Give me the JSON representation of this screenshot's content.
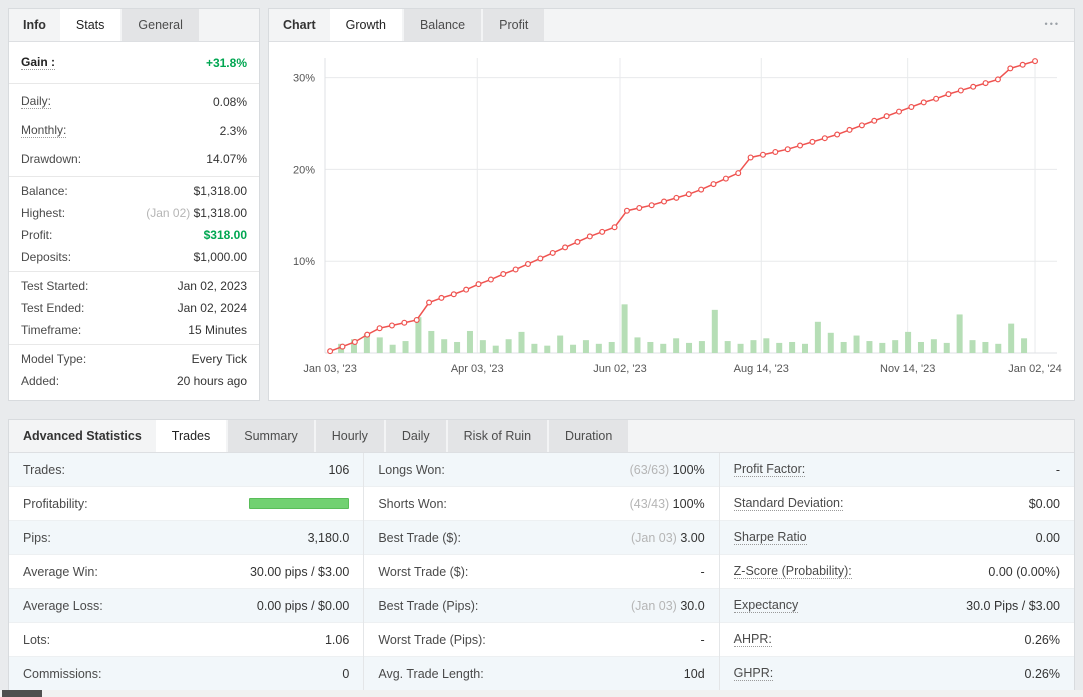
{
  "colors": {
    "accent_green": "#00a651",
    "line_red": "#ef5350",
    "bar_green": "#b6deb6",
    "profitability_green": "#71d171",
    "grid_gray": "#e8eaec",
    "muted_gray": "#b5b5b5"
  },
  "info_panel": {
    "title": "Info",
    "tabs": [
      {
        "label": "Stats",
        "active": true
      },
      {
        "label": "General",
        "active": false
      }
    ],
    "sections": [
      {
        "rows": [
          {
            "label": "Gain :",
            "value": "+31.8%",
            "dotted": true,
            "bold_label": true,
            "green": true,
            "size": "gain"
          }
        ]
      },
      {
        "rows": [
          {
            "label": "Daily:",
            "value": "0.08%",
            "dotted": true,
            "size": "tall"
          },
          {
            "label": "Monthly:",
            "value": "2.3%",
            "dotted": true,
            "size": "tall"
          },
          {
            "label": "Drawdown:",
            "value": "14.07%",
            "size": "tall"
          }
        ]
      },
      {
        "rows": [
          {
            "label": "Balance:",
            "value": "$1,318.00"
          },
          {
            "label": "Highest:",
            "prefix": "(Jan 02) ",
            "value": "$1,318.00"
          },
          {
            "label": "Profit:",
            "value": "$318.00",
            "green": true
          },
          {
            "label": "Deposits:",
            "value": "$1,000.00"
          }
        ]
      },
      {
        "rows": [
          {
            "label": "Test Started:",
            "value": "Jan 02, 2023"
          },
          {
            "label": "Test Ended:",
            "value": "Jan 02, 2024"
          },
          {
            "label": "Timeframe:",
            "value": "15 Minutes"
          }
        ]
      },
      {
        "rows": [
          {
            "label": "Model Type:",
            "value": "Every Tick"
          },
          {
            "label": "Added:",
            "value": "20 hours ago"
          }
        ]
      }
    ]
  },
  "chart_panel": {
    "title": "Chart",
    "tabs": [
      {
        "label": "Growth",
        "active": true
      },
      {
        "label": "Balance",
        "active": false
      },
      {
        "label": "Profit",
        "active": false
      }
    ],
    "menu_icon": "•••"
  },
  "chart_data": {
    "type": "line",
    "title": "Growth",
    "ylabel": "%",
    "ylim": [
      0,
      32
    ],
    "yticks": [
      10,
      20,
      30
    ],
    "ytick_suffix": "%",
    "grid": true,
    "xticks": [
      {
        "label": "Jan 03, '23",
        "pos": 0.007,
        "grid": false
      },
      {
        "label": "Apr 03, '23",
        "pos": 0.208,
        "grid": true
      },
      {
        "label": "Jun 02, '23",
        "pos": 0.403,
        "grid": true
      },
      {
        "label": "Aug 14, '23",
        "pos": 0.596,
        "grid": true
      },
      {
        "label": "Nov 14, '23",
        "pos": 0.796,
        "grid": true
      },
      {
        "label": "Jan 02, '24",
        "pos": 0.97,
        "grid": true
      }
    ],
    "series": [
      {
        "name": "growth-percent-line",
        "type": "line",
        "color": "#ef5350",
        "marker": "circle",
        "x_range": [
          0.007,
          0.97
        ],
        "values": [
          0.2,
          0.7,
          1.2,
          2.0,
          2.7,
          3.0,
          3.3,
          3.6,
          5.5,
          6.0,
          6.4,
          6.9,
          7.5,
          8.0,
          8.6,
          9.1,
          9.7,
          10.3,
          10.9,
          11.5,
          12.1,
          12.7,
          13.2,
          13.7,
          15.5,
          15.8,
          16.1,
          16.5,
          16.9,
          17.3,
          17.8,
          18.4,
          19.0,
          19.6,
          21.3,
          21.6,
          21.9,
          22.2,
          22.6,
          23.0,
          23.4,
          23.8,
          24.3,
          24.8,
          25.3,
          25.8,
          26.3,
          26.8,
          27.3,
          27.7,
          28.2,
          28.6,
          29.0,
          29.4,
          29.8,
          31.0,
          31.4,
          31.8
        ]
      },
      {
        "name": "period-gain-bars",
        "type": "bar",
        "color": "#b6deb6",
        "x_range": [
          0.022,
          0.955
        ],
        "values": [
          1.0,
          1.5,
          2.1,
          1.7,
          0.9,
          1.3,
          3.9,
          2.4,
          1.5,
          1.2,
          2.4,
          1.4,
          0.8,
          1.5,
          2.3,
          1.0,
          0.8,
          1.9,
          0.9,
          1.4,
          1.0,
          1.2,
          5.3,
          1.7,
          1.2,
          1.0,
          1.6,
          1.1,
          1.3,
          4.7,
          1.3,
          1.0,
          1.4,
          1.6,
          1.1,
          1.2,
          1.0,
          3.4,
          2.2,
          1.2,
          1.9,
          1.3,
          1.1,
          1.4,
          2.3,
          1.2,
          1.5,
          1.1,
          4.2,
          1.4,
          1.2,
          1.0,
          3.2,
          1.6
        ]
      }
    ]
  },
  "stats_panel": {
    "title": "Advanced Statistics",
    "tabs": [
      {
        "label": "Trades",
        "active": true
      },
      {
        "label": "Summary",
        "active": false
      },
      {
        "label": "Hourly",
        "active": false
      },
      {
        "label": "Daily",
        "active": false
      },
      {
        "label": "Risk of Ruin",
        "active": false
      },
      {
        "label": "Duration",
        "active": false
      }
    ],
    "columns": [
      [
        {
          "label": "Trades:",
          "value": "106"
        },
        {
          "label": "Profitability:",
          "bar": true
        },
        {
          "label": "Pips:",
          "value": "3,180.0"
        },
        {
          "label": "Average Win:",
          "value": "30.00 pips / $3.00"
        },
        {
          "label": "Average Loss:",
          "value": "0.00 pips / $0.00"
        },
        {
          "label": "Lots:",
          "value": "1.06"
        },
        {
          "label": "Commissions:",
          "value": "0"
        }
      ],
      [
        {
          "label": "Longs Won:",
          "prefix": "(63/63) ",
          "value": "100%"
        },
        {
          "label": "Shorts Won:",
          "prefix": "(43/43) ",
          "value": "100%"
        },
        {
          "label": "Best Trade ($):",
          "prefix": "(Jan 03) ",
          "value": "3.00"
        },
        {
          "label": "Worst Trade ($):",
          "value": "-"
        },
        {
          "label": "Best Trade (Pips):",
          "prefix": "(Jan 03) ",
          "value": "30.0"
        },
        {
          "label": "Worst Trade (Pips):",
          "value": "-"
        },
        {
          "label": "Avg. Trade Length:",
          "value": "10d"
        }
      ],
      [
        {
          "label": "Profit Factor:",
          "value": "-",
          "dotted": true
        },
        {
          "label": "Standard Deviation:",
          "value": "$0.00",
          "dotted": true
        },
        {
          "label": "Sharpe Ratio",
          "value": "0.00",
          "dotted": true
        },
        {
          "label": "Z-Score (Probability):",
          "value": "0.00 (0.00%)",
          "dotted": true
        },
        {
          "label": "Expectancy",
          "value": "30.0 Pips / $3.00",
          "dotted": true
        },
        {
          "label": "AHPR:",
          "value": "0.26%",
          "dotted": true
        },
        {
          "label": "GHPR:",
          "value": "0.26%",
          "dotted": true
        }
      ]
    ]
  }
}
